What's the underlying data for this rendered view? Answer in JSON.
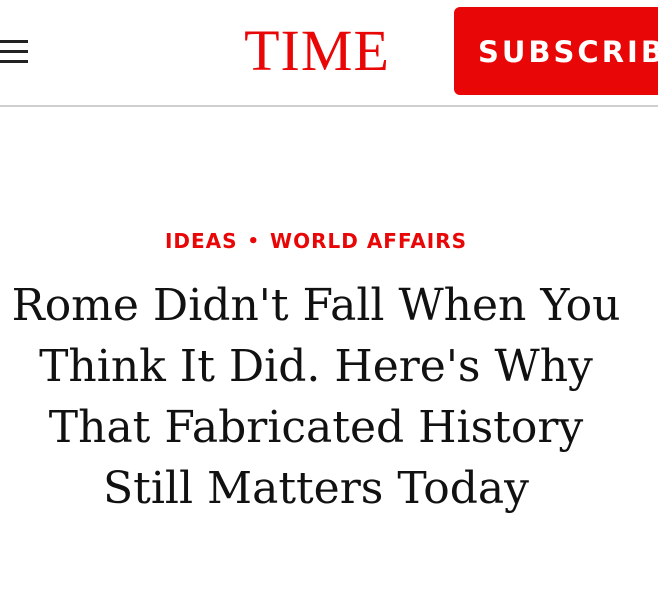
{
  "header": {
    "menu_icon": "hamburger-menu-icon",
    "logo_text": "TIME",
    "subscribe_label": "SUBSCRIBE",
    "brand_color": "#e90606"
  },
  "article": {
    "section_primary": "IDEAS",
    "section_separator": "•",
    "section_secondary": "WORLD AFFAIRS",
    "headline": "Rome Didn't Fall When You Think It Did. Here's Why That Fabricated History Still Matters Today"
  }
}
